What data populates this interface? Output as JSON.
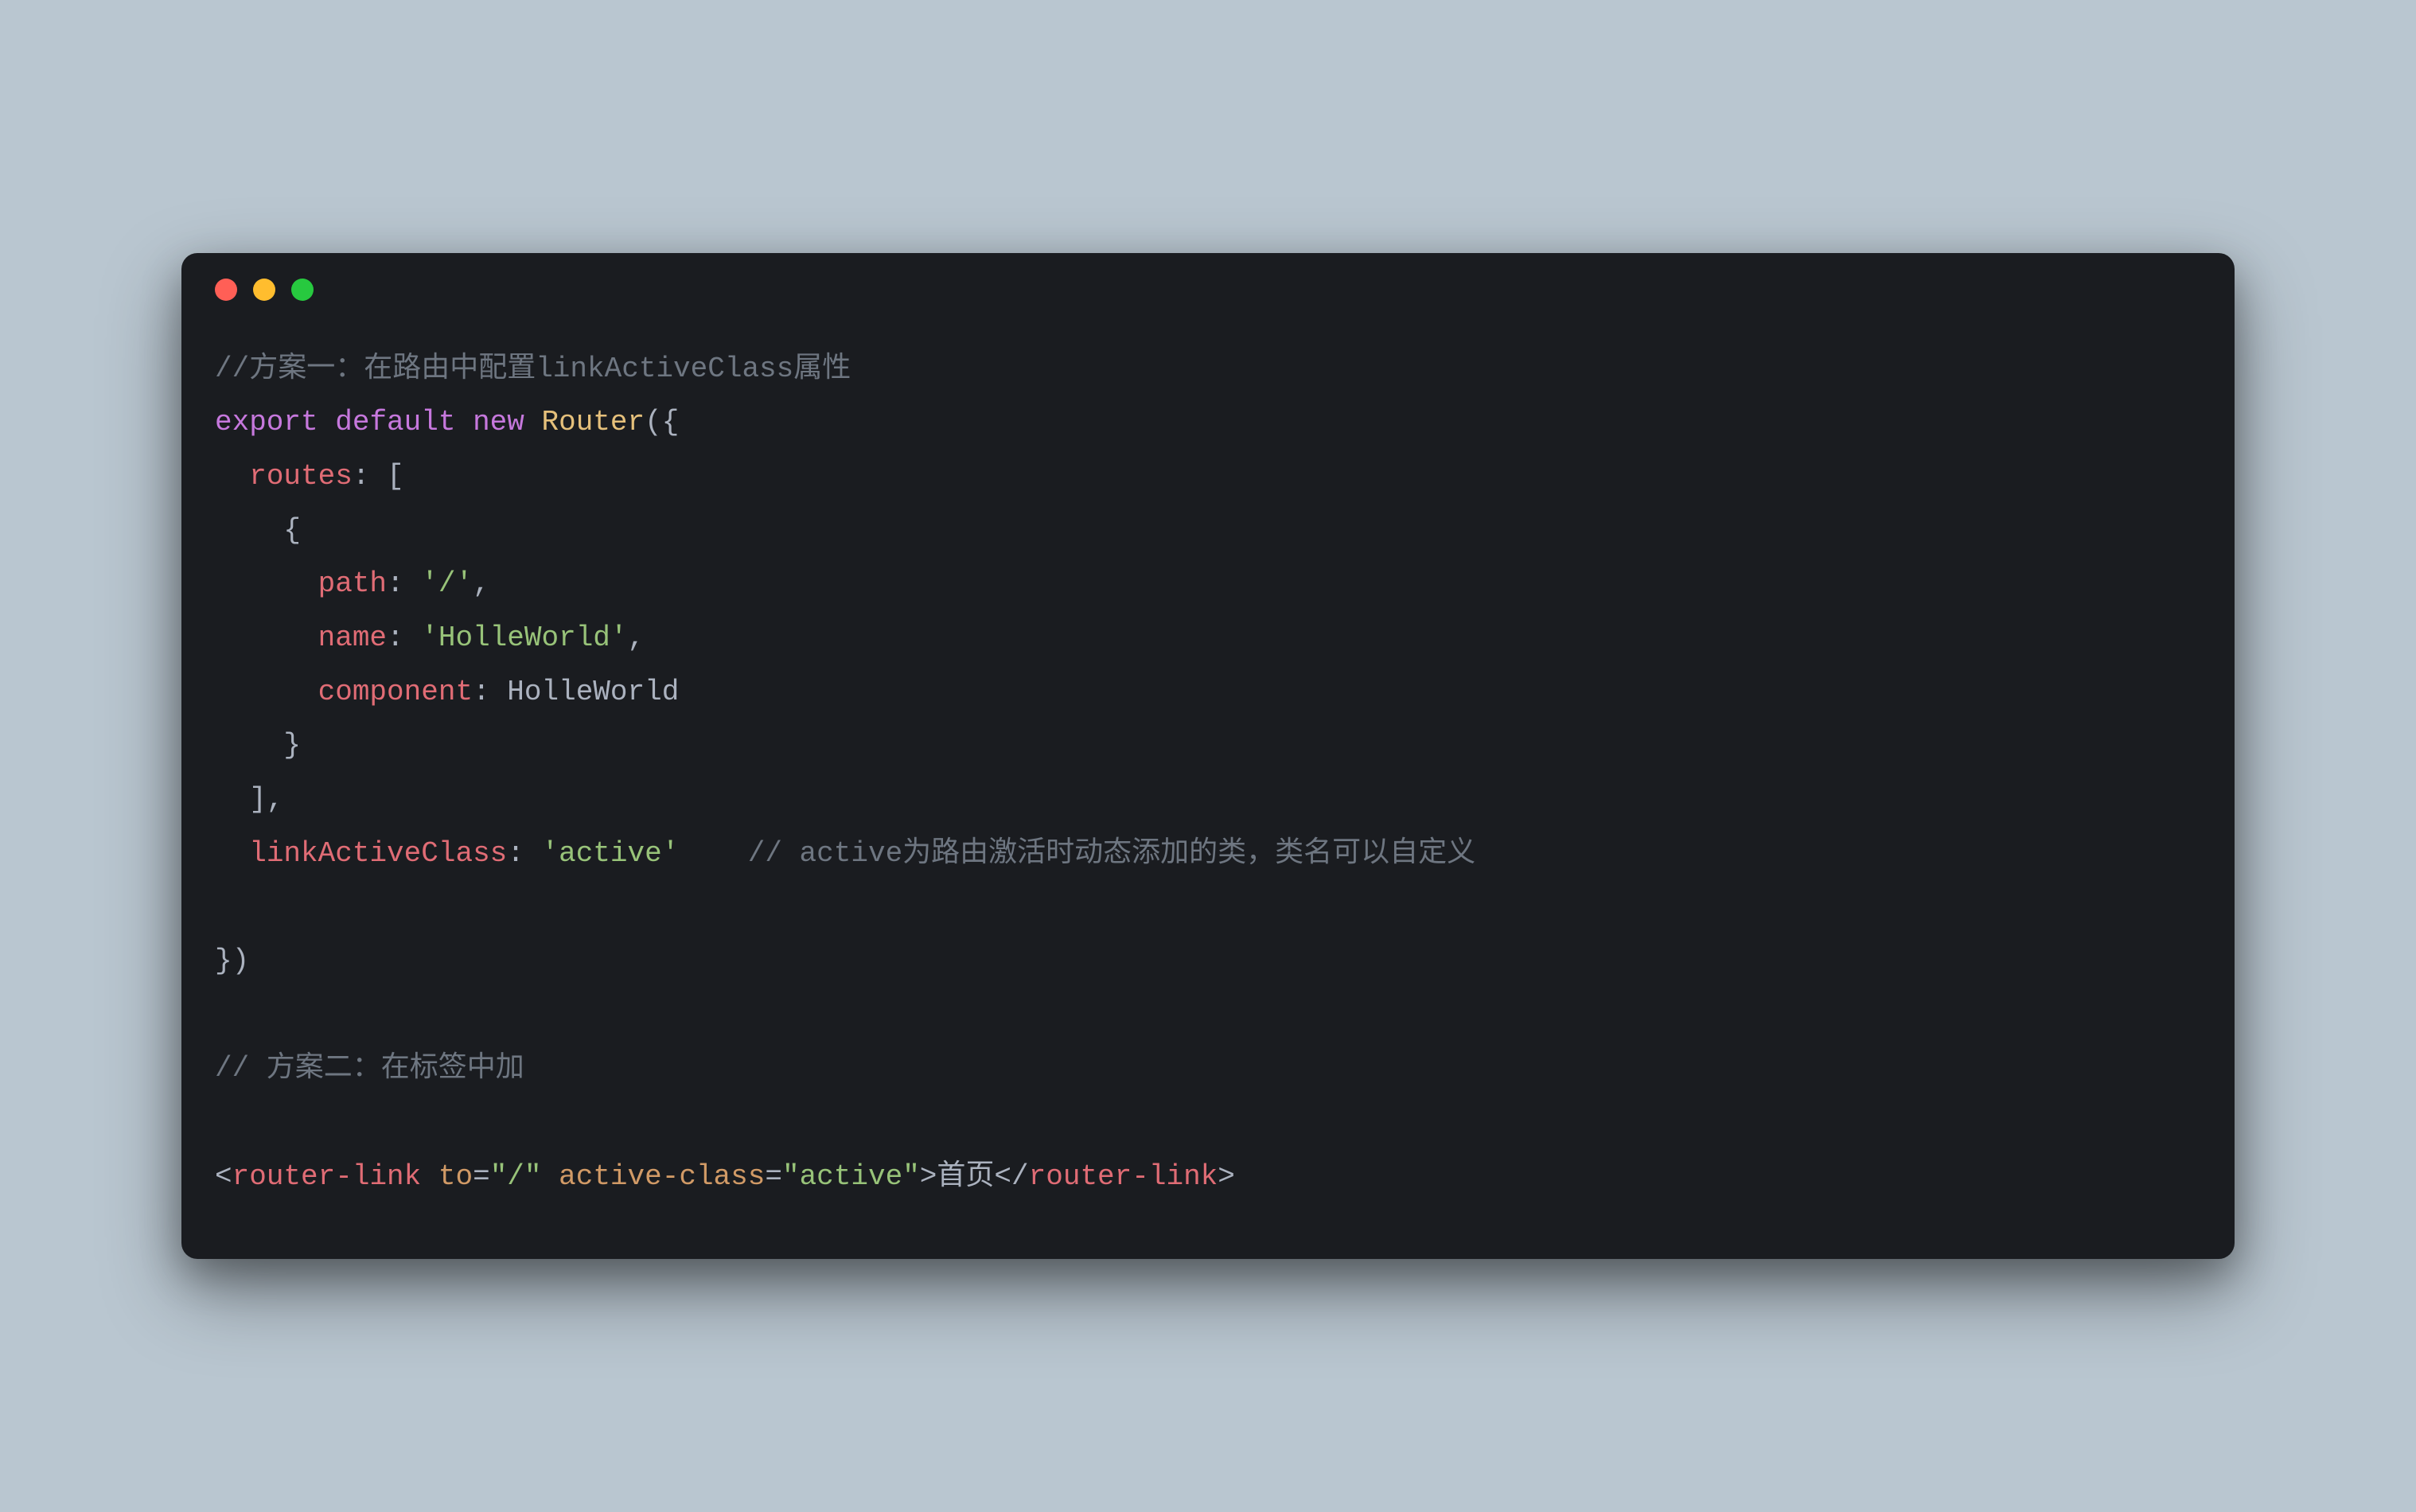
{
  "code": {
    "c1": "//方案一：在路由中配置linkActiveClass属性",
    "kw_export": "export",
    "kw_default": "default",
    "kw_new": "new",
    "Router": "Router",
    "paren_open": "(",
    "brace_open": "{",
    "routes_key": "routes",
    "colon": ":",
    "bracket_open": "[",
    "path_key": "path",
    "path_val": "'/'",
    "comma": ",",
    "name_key": "name",
    "name_val": "'HolleWorld'",
    "component_key": "component",
    "component_val": "HolleWorld",
    "brace_close": "}",
    "bracket_close": "]",
    "lac_key": "linkActiveClass",
    "lac_val": "'active'",
    "c2": "// active为路由激活时动态添加的类，类名可以自定义",
    "paren_close": ")",
    "c3": "// 方案二：在标签中加",
    "lt": "<",
    "router_link": "router-link",
    "to_attr": "to",
    "eq": "=",
    "to_val": "\"/\"",
    "ac_attr": "active-class",
    "ac_val": "\"active\"",
    "gt": ">",
    "link_text": "首页",
    "close_slash": "</",
    "sp": " ",
    "sp4": "    ",
    "sp6": "      ",
    "sp2": "  "
  }
}
